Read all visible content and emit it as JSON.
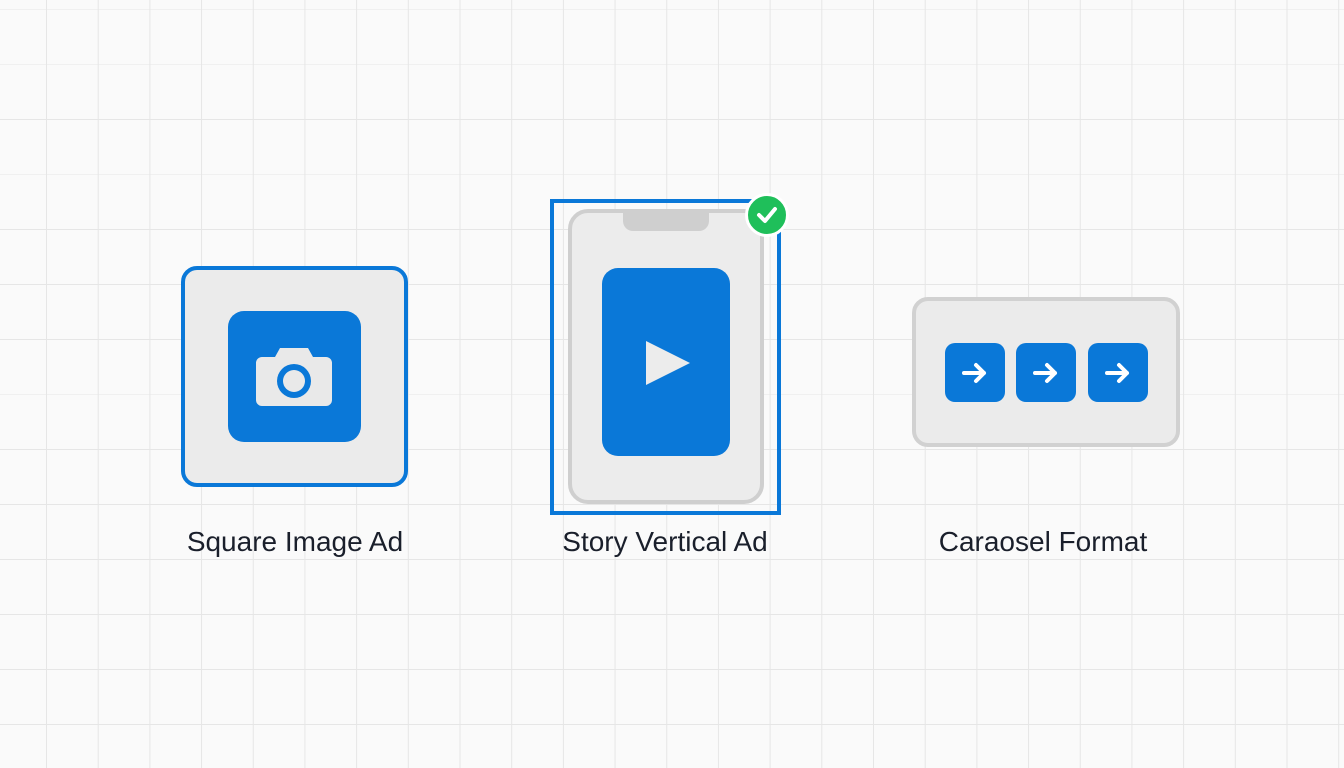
{
  "options": [
    {
      "label": "Square Image Ad",
      "icon": "camera-icon",
      "selected": false
    },
    {
      "label": "Story Vertical Ad",
      "icon": "play-icon",
      "selected": true
    },
    {
      "label": "Caraosel Format",
      "icon": "arrow-right-icon",
      "selected": false
    }
  ],
  "colors": {
    "accent": "#0a78d8",
    "selected_check": "#1fbf5a",
    "card_background": "#ebebeb",
    "card_border_unselected": "#d1d1d1",
    "text": "#1a1f2b"
  },
  "selection_badge": {
    "icon": "check-icon"
  }
}
